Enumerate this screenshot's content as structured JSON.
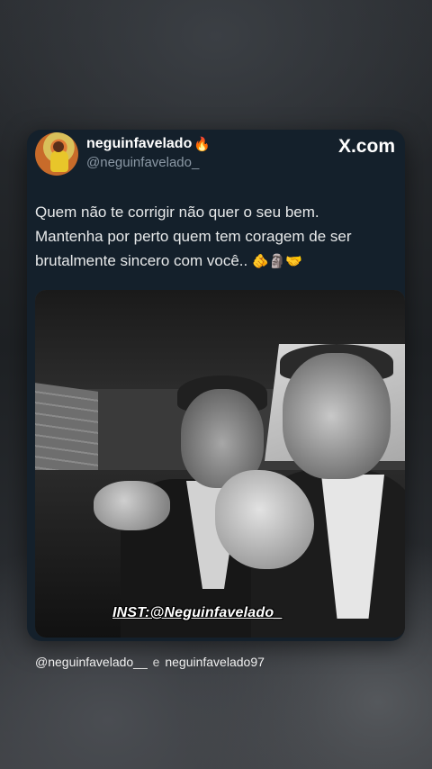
{
  "tweet": {
    "display_name": "neguinfavelado",
    "name_emoji": "🔥",
    "handle": "@neguinfavelado_",
    "brand": "X.com",
    "text_line1": "Quem não te corrigir não quer o seu bem.",
    "text_line2": "Mantenha por perto quem tem coragem de ser",
    "text_line3": "brutalmente sincero com você..",
    "emojis": "🫵🗿🤝",
    "watermark": "INST:@Neguinfavelado_"
  },
  "footer": {
    "account1": "@neguinfavelado__",
    "separator": "e",
    "account2": "neguinfavelado97"
  },
  "colors": {
    "card_bg": "#14202b",
    "handle_gray": "#8b98a5",
    "text": "#e7e9ea"
  }
}
